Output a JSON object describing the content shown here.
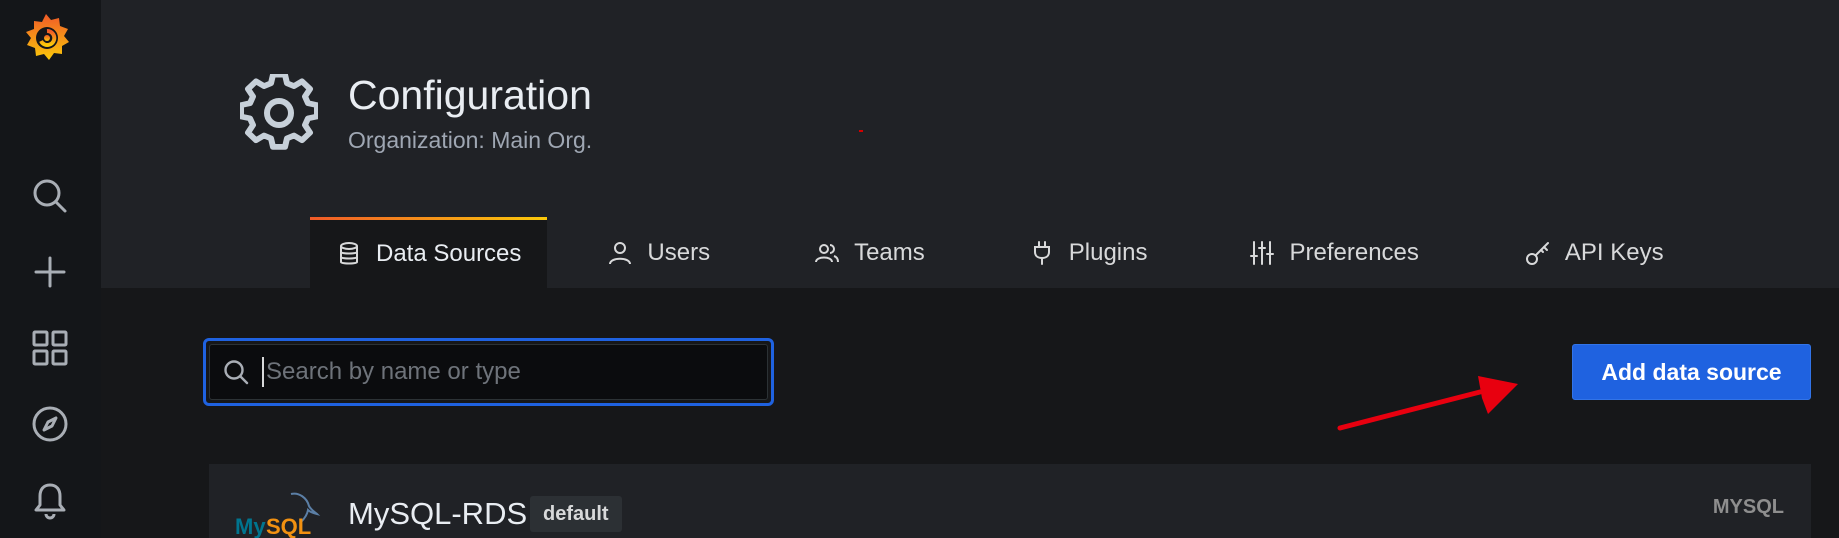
{
  "sidebar": {
    "logo": "grafana-logo-icon",
    "items": [
      {
        "name": "search",
        "icon": "search-icon"
      },
      {
        "name": "create",
        "icon": "plus-icon"
      },
      {
        "name": "dashboards",
        "icon": "dashboards-icon"
      },
      {
        "name": "explore",
        "icon": "compass-icon"
      },
      {
        "name": "alerting",
        "icon": "bell-icon"
      }
    ]
  },
  "header": {
    "icon": "gear-icon",
    "title": "Configuration",
    "subtitle": "Organization: Main Org."
  },
  "tabs": [
    {
      "label": "Data Sources",
      "icon": "database-icon",
      "active": true
    },
    {
      "label": "Users",
      "icon": "user-icon",
      "active": false
    },
    {
      "label": "Teams",
      "icon": "users-icon",
      "active": false
    },
    {
      "label": "Plugins",
      "icon": "plug-icon",
      "active": false
    },
    {
      "label": "Preferences",
      "icon": "sliders-icon",
      "active": false
    },
    {
      "label": "API Keys",
      "icon": "key-icon",
      "active": false
    }
  ],
  "toolbar": {
    "search_placeholder": "Search by name or type",
    "search_value": "",
    "add_button_label": "Add data source"
  },
  "datasources": [
    {
      "name": "MySQL-RDS",
      "badge": "default",
      "type": "MYSQL",
      "logo": "mysql-logo"
    }
  ],
  "colors": {
    "accent": "#1f62e0",
    "tab_gradient_start": "#f05a28",
    "tab_gradient_end": "#fbca0a",
    "annotation": "#e8000f"
  }
}
